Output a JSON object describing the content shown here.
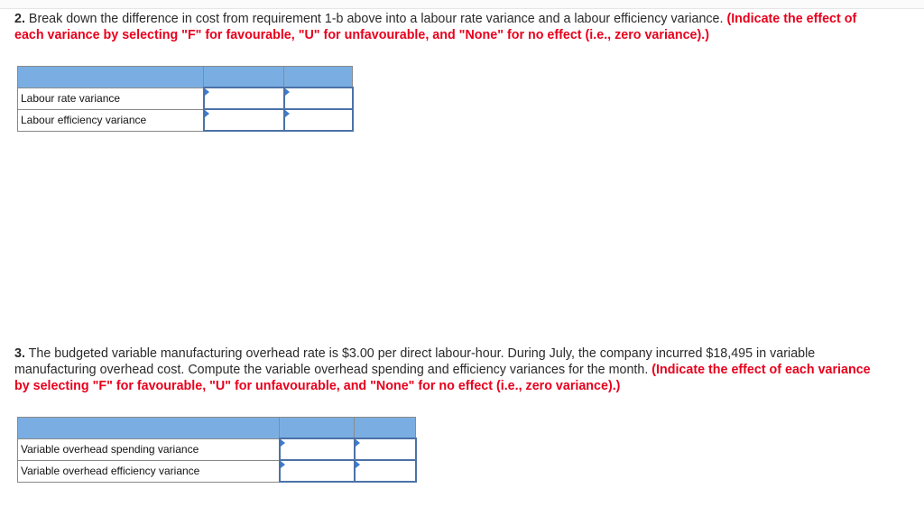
{
  "question2": {
    "number": "2.",
    "text": " Break down the difference in cost from requirement 1-b above into a labour rate variance and a labour efficiency variance. ",
    "instruction": "(Indicate the effect of each variance by selecting \"F\" for favourable, \"U\" for unfavourable, and \"None\" for no effect (i.e., zero variance).)",
    "table": {
      "header": [
        "",
        "",
        ""
      ],
      "rows": [
        {
          "label": "Labour rate variance",
          "amount": "",
          "effect": ""
        },
        {
          "label": "Labour efficiency variance",
          "amount": "",
          "effect": ""
        }
      ]
    }
  },
  "question3": {
    "number": "3.",
    "text": " The budgeted variable manufacturing overhead rate is $3.00 per direct labour-hour. During July, the company incurred $18,495 in variable manufacturing overhead cost. Compute the variable overhead spending and efficiency variances for the month. ",
    "instruction": "(Indicate the effect of each variance by selecting \"F\" for favourable, \"U\" for unfavourable, and \"None\" for no effect (i.e., zero variance).)",
    "table": {
      "header": [
        "",
        "",
        ""
      ],
      "rows": [
        {
          "label": "Variable overhead spending variance",
          "amount": "",
          "effect": ""
        },
        {
          "label": "Variable overhead efficiency variance",
          "amount": "",
          "effect": ""
        }
      ]
    }
  },
  "colors": {
    "header_fill": "#7aaee2",
    "input_border": "#4c72a6",
    "instruction_red": "#e8001c",
    "dropdown_marker": "#3a7bd5"
  }
}
